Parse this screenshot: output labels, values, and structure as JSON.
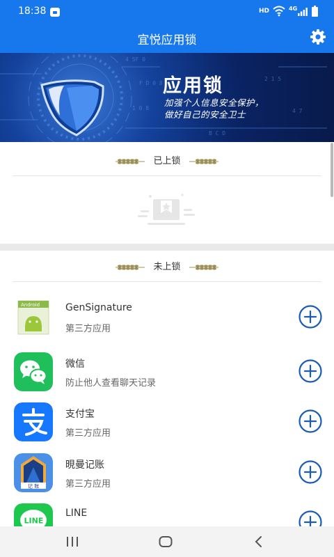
{
  "status_bar": {
    "time": "18:38",
    "hd": "HD",
    "network": "4G"
  },
  "app_bar": {
    "title": "宜悦应用锁",
    "settings_icon": "gear-icon"
  },
  "banner": {
    "title": "应用锁",
    "line1": "加强个人信息安全保护，",
    "line2": "做好自己的安全卫士",
    "shield_icon": "shield-icon"
  },
  "locked_section": {
    "title": "已上锁",
    "empty_icon": "empty-list-icon"
  },
  "unlocked_section": {
    "title": "未上锁",
    "apps": [
      {
        "name": "GenSignature",
        "desc": "第三方应用",
        "icon": "android-app-icon"
      },
      {
        "name": "微信",
        "desc": "防止他人查看聊天记录",
        "icon": "wechat-icon"
      },
      {
        "name": "支付宝",
        "desc": "第三方应用",
        "icon": "alipay-icon"
      },
      {
        "name": "晛曼记账",
        "desc": "第三方应用",
        "icon": "bookkeeping-icon"
      },
      {
        "name": "LINE",
        "desc": "",
        "icon": "line-icon"
      }
    ]
  },
  "colors": {
    "primary": "#1778ee",
    "add_button": "#1a5bb5",
    "wechat": "#1fc05b",
    "alipay": "#1677ff",
    "line": "#1ec84e"
  }
}
